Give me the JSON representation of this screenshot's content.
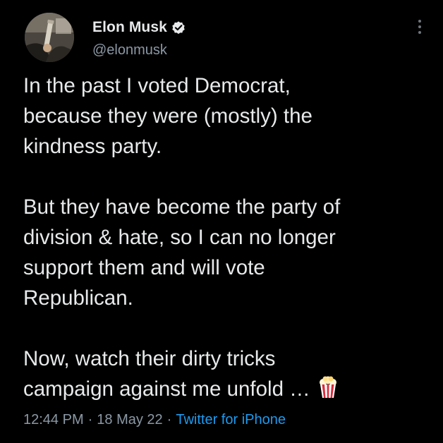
{
  "author": {
    "display_name": "Elon Musk",
    "handle": "@elonmusk",
    "verified": true
  },
  "tweet": {
    "paragraphs": [
      [
        "In the past I voted Democrat,",
        "because they were (mostly) the",
        "kindness party."
      ],
      [
        "But they have become the party of",
        "division & hate, so I can no longer",
        "support them and will vote",
        "Republican."
      ],
      [
        "Now, watch their dirty tricks",
        "campaign against me unfold …"
      ]
    ],
    "trailing_emoji": "popcorn"
  },
  "meta": {
    "time": "12:44 PM",
    "separator": "·",
    "date": "18 May 22",
    "source": "Twitter for iPhone"
  },
  "colors": {
    "background": "#000000",
    "text": "#e7e9ea",
    "secondary": "#8b98a5",
    "link": "#1d9bf0",
    "verified_badge": "#e7e9ea"
  },
  "icons": {
    "verified": "verified-badge-icon",
    "more": "more-options-icon",
    "emoji": "popcorn-icon"
  }
}
